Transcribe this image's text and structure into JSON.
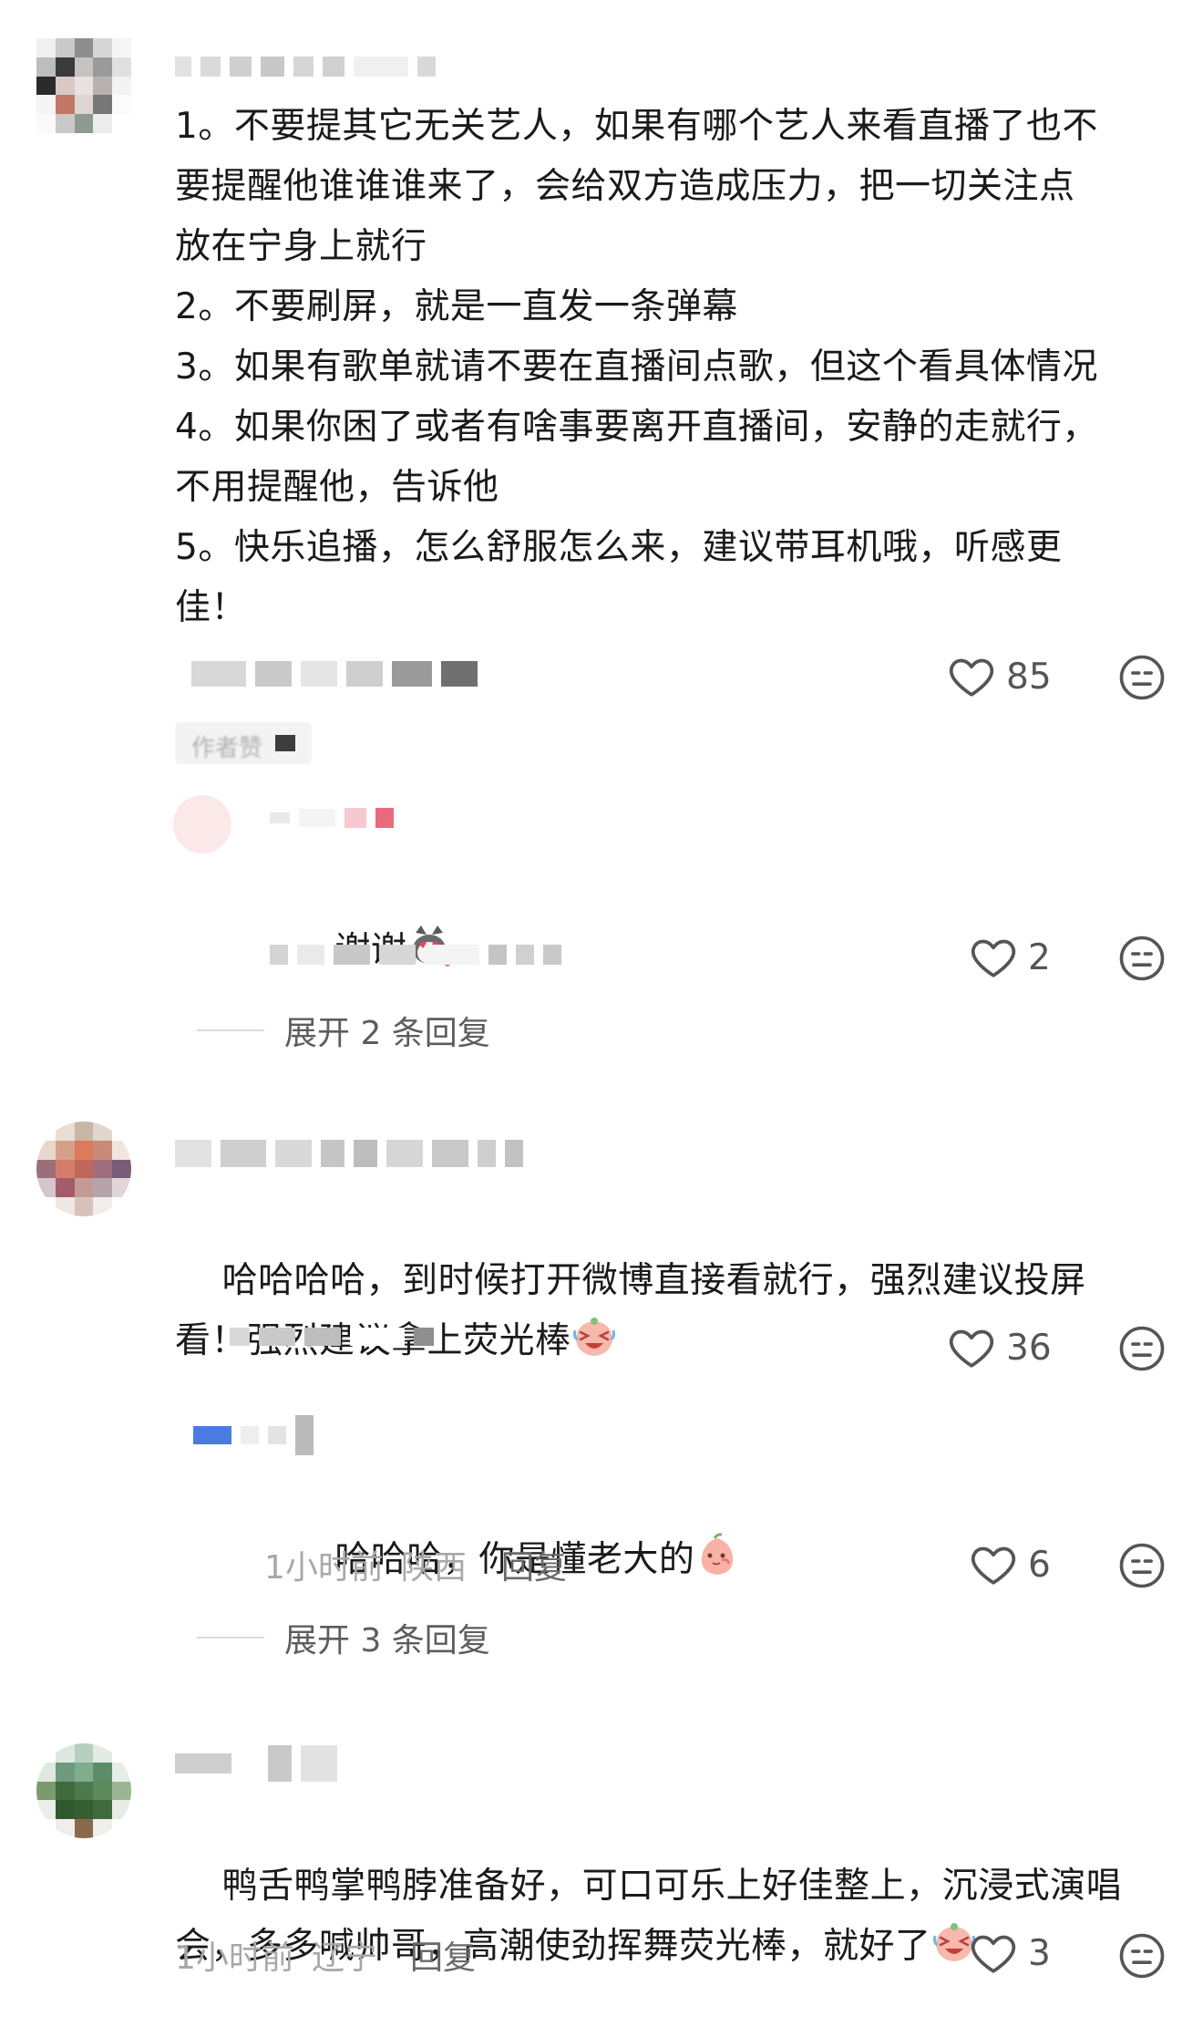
{
  "comments": [
    {
      "text": "1。不要提其它无关艺人，如果有哪个艺人来看直播了也不\n要提醒他谁谁谁来了，会给双方造成压力，把一切关注点\n放在宁身上就行\n2。不要刷屏，就是一直发一条弹幕\n3。如果有歌单就请不要在直播间点歌，但这个看具体情况\n4。如果你困了或者有啥事要离开直播间，安静的走就行，\n不用提醒他，告诉他\n5。快乐追播，怎么舒服怎么来，建议带耳机哦，听感更\n佳！",
      "likes": "85",
      "author_badge": "作者赞",
      "reply": {
        "text": "谢谢",
        "emoji": "husky-heart-eyes-emoji",
        "likes": "2"
      },
      "expand_label": "展开 2 条回复"
    },
    {
      "text": "哈哈哈哈，到时候打开微博直接看就行，强烈建议投屏\n看！强烈建议拿上荧光棒",
      "emoji": "crying-laughing-face-emoji",
      "likes": "36",
      "reply": {
        "text": "哈哈哈，你是懂老大的",
        "emoji": "shy-peach-emoji",
        "time": "1小时前",
        "location": "陕西",
        "reply_label": "回复",
        "likes": "6"
      },
      "expand_label": "展开 3 条回复"
    },
    {
      "text": "鸭舌鸭掌鸭脖准备好，可口可乐上好佳整上，沉浸式演唱\n会，多多喊帅哥，高潮使劲挥舞荧光棒，就好了",
      "emoji": "crying-laughing-face-emoji",
      "time": "1小时前",
      "location": "辽宁",
      "reply_label": "回复",
      "likes": "3"
    }
  ],
  "icons": {
    "like": "heart-outline-icon",
    "dislike": "neutral-face-icon"
  },
  "colors": {
    "text": "#1a1a1a",
    "meta": "#a8a8a8",
    "icon": "#555555",
    "reply_link": "#6a6a6a"
  }
}
